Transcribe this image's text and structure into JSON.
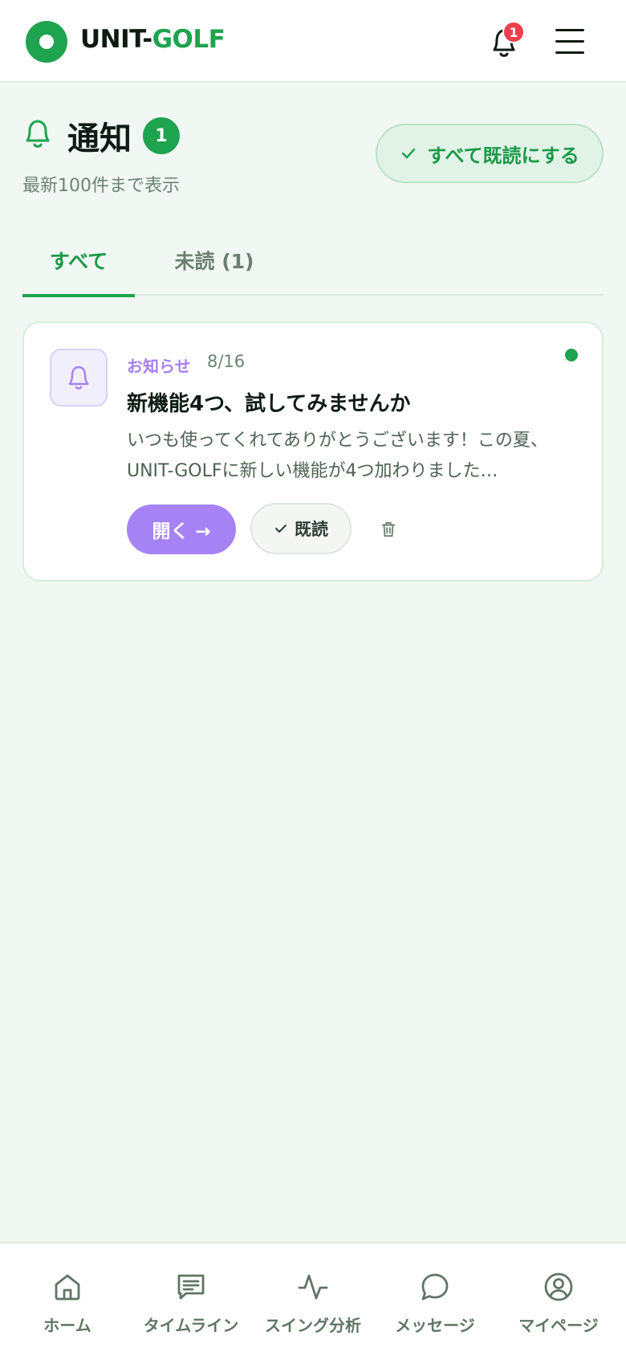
{
  "header": {
    "brand_part1": "UNIT-",
    "brand_part2": "GOLF",
    "notification_count": "1"
  },
  "page": {
    "title": "通知",
    "unread_badge": "1",
    "subtitle": "最新100件まで表示",
    "mark_all_read": "すべて既読にする"
  },
  "tabs": [
    {
      "label": "すべて",
      "active": true
    },
    {
      "label": "未読 (1)",
      "active": false
    }
  ],
  "notifications": [
    {
      "category": "お知らせ",
      "date": "8/16",
      "title": "新機能4つ、試してみませんか",
      "body": "いつも使ってくれてありがとうございます！この夏、UNIT-GOLFに新しい機能が4つ加わりました…",
      "open_label": "開く →",
      "read_label": "既読",
      "unread": true
    }
  ],
  "bottom_nav": [
    {
      "label": "ホーム",
      "icon": "home-icon"
    },
    {
      "label": "タイムライン",
      "icon": "timeline-icon"
    },
    {
      "label": "スイング分析",
      "icon": "activity-icon"
    },
    {
      "label": "メッセージ",
      "icon": "message-icon"
    },
    {
      "label": "マイページ",
      "icon": "user-icon"
    }
  ],
  "colors": {
    "brand_green": "#1ea34f",
    "accent_purple": "#a683f5",
    "badge_red": "#ef3e4a",
    "background": "#f1f7f3"
  }
}
